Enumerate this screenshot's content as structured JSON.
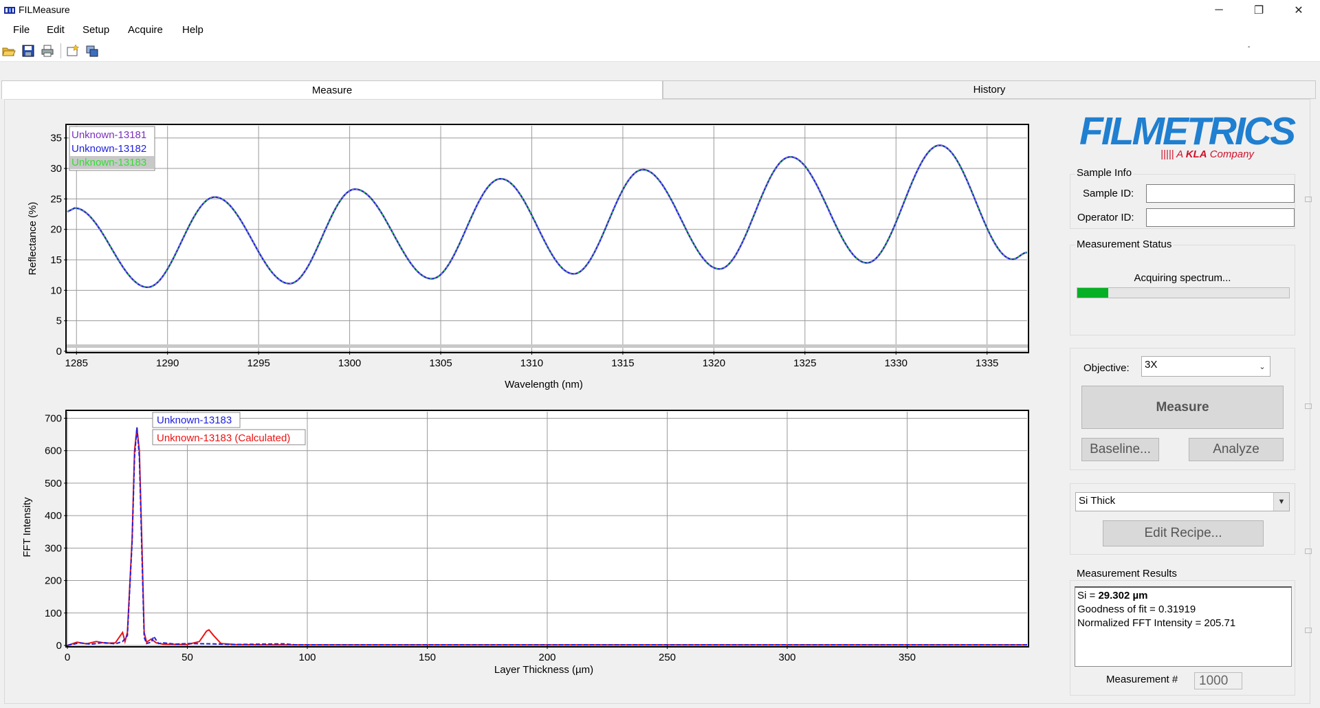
{
  "window": {
    "title": "FILMeasure",
    "minimize": "─",
    "maximize": "❐",
    "close": "✕"
  },
  "menu": [
    "File",
    "Edit",
    "Setup",
    "Acquire",
    "Help"
  ],
  "toolbar": [
    "open-folder-icon",
    "save-icon",
    "print-icon",
    "new-icon",
    "copy-icon"
  ],
  "tabs": {
    "measure": "Measure",
    "history": "History"
  },
  "brand": {
    "logo": "FILMETRICS",
    "tagline_prefix": "||||| A ",
    "tagline_kla": "KLA",
    "tagline_suffix": " Company",
    "logo_color": "#1f7fd0",
    "tagline_color": "#d0102a"
  },
  "sample_info": {
    "title": "Sample Info",
    "sample_id_label": "Sample ID:",
    "sample_id_value": "",
    "operator_id_label": "Operator ID:",
    "operator_id_value": ""
  },
  "measurement_status": {
    "title": "Measurement Status",
    "status_text": "Acquiring spectrum...",
    "progress_fraction": 0.145,
    "progress_color": "#06b025"
  },
  "controls": {
    "objective_label": "Objective:",
    "objective_value": "3X",
    "measure_button": "Measure",
    "baseline_button": "Baseline...",
    "analyze_button": "Analyze"
  },
  "recipe": {
    "selected": "Si Thick",
    "edit_button": "Edit Recipe..."
  },
  "results": {
    "title": "Measurement Results",
    "line1_prefix": "Si = ",
    "line1_value": "29.302 µm",
    "line2": "Goodness of fit = 0.31919",
    "line3": "Normalized FFT Intensity = 205.71",
    "measurement_num_label": "Measurement #",
    "measurement_num_value": "1000"
  },
  "chart_data": [
    {
      "type": "line",
      "xlabel": "Wavelength (nm)",
      "ylabel": "Reflectance (%)",
      "xlim": [
        1284.5,
        1337.2
      ],
      "ylim": [
        0,
        37
      ],
      "xticks": [
        "1285",
        "1290",
        "1295",
        "1300",
        "1305",
        "1310",
        "1315",
        "1320",
        "1325",
        "1330",
        "1335"
      ],
      "yticks": [
        "0",
        "5",
        "10",
        "15",
        "20",
        "25",
        "30",
        "35"
      ],
      "grid": true,
      "legend_position": "top-left",
      "series": [
        {
          "name": "Unknown-13181",
          "color": "#7b2fbf"
        },
        {
          "name": "Unknown-13182",
          "color": "#2020e0"
        },
        {
          "name": "Unknown-13183",
          "color": "#33dd33"
        }
      ],
      "peaks": [
        [
          1284.9,
          23.5
        ],
        [
          1292.6,
          25.3
        ],
        [
          1300.3,
          26.6
        ],
        [
          1308.3,
          28.3
        ],
        [
          1316.1,
          29.8
        ],
        [
          1324.2,
          31.9
        ],
        [
          1332.4,
          33.8
        ]
      ],
      "troughs": [
        [
          1288.9,
          10.5
        ],
        [
          1296.7,
          11.1
        ],
        [
          1304.5,
          11.9
        ],
        [
          1312.3,
          12.7
        ],
        [
          1320.3,
          13.5
        ],
        [
          1328.4,
          14.5
        ],
        [
          1336.4,
          15.1
        ]
      ],
      "end_point": [
        1337.2,
        16.2
      ]
    },
    {
      "type": "line",
      "xlabel": "Layer Thickness (µm)",
      "ylabel": "FFT Intensity",
      "xlim": [
        0,
        400
      ],
      "ylim": [
        0,
        720
      ],
      "xticks": [
        "0",
        "50",
        "100",
        "150",
        "200",
        "250",
        "300",
        "350"
      ],
      "yticks": [
        "0",
        "100",
        "200",
        "300",
        "400",
        "500",
        "600",
        "700"
      ],
      "grid": true,
      "legend_position": "top-left",
      "series": [
        {
          "name": "Unknown-13183",
          "color": "#2020e0",
          "x": [
            0,
            5,
            10,
            15,
            20,
            23,
            25,
            27,
            28,
            29,
            30,
            31,
            32,
            33,
            35,
            36,
            38,
            40,
            45,
            50,
            60,
            70,
            80,
            90,
            95,
            400
          ],
          "y": [
            0,
            8,
            4,
            9,
            5,
            12,
            30,
            320,
            580,
            672,
            580,
            300,
            25,
            6,
            10,
            28,
            6,
            8,
            4,
            6,
            5,
            3,
            4,
            5,
            2,
            2
          ]
        },
        {
          "name": "Unknown-13183 (Calculated)",
          "color": "#ee1111",
          "x": [
            0,
            4,
            8,
            12,
            16,
            20,
            23,
            24,
            25,
            27,
            28,
            29,
            30,
            31,
            32,
            33,
            35,
            37,
            40,
            50,
            55,
            58,
            59,
            61,
            64,
            70,
            80,
            400
          ],
          "y": [
            0,
            10,
            5,
            12,
            7,
            8,
            40,
            12,
            40,
            330,
            600,
            670,
            600,
            330,
            40,
            10,
            20,
            8,
            4,
            3,
            12,
            44,
            48,
            30,
            6,
            3,
            2,
            2
          ]
        }
      ]
    }
  ]
}
